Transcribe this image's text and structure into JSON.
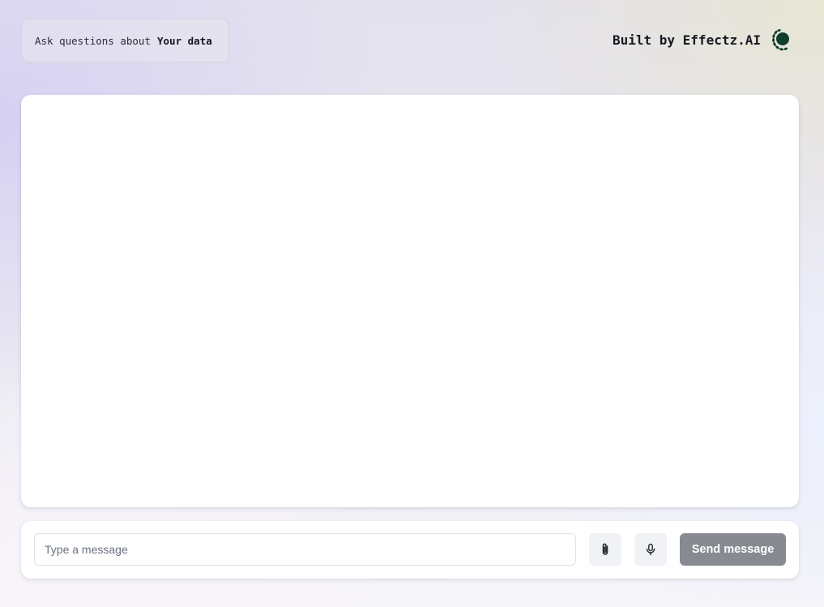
{
  "header": {
    "topic_prefix": "Ask questions about",
    "topic_highlight": "Your data",
    "brand_text": "Built by Effectz.AI",
    "brand_logo_icon": "leaf-globe-icon",
    "brand_logo_color": "#0f3d2e"
  },
  "chat": {
    "messages": []
  },
  "composer": {
    "placeholder": "Type a message",
    "value": "",
    "attach_icon": "paperclip-icon",
    "mic_icon": "microphone-icon",
    "send_label": "Send message",
    "send_color": "#878a91"
  }
}
